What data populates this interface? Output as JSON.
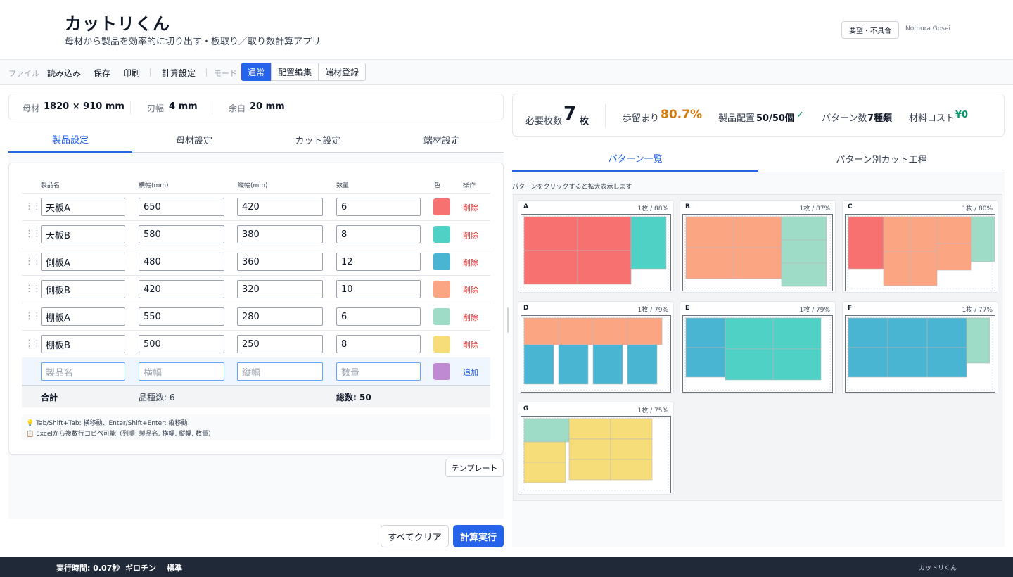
{
  "header": {
    "title": "カットリくん",
    "subtitle": "母材から製品を効率的に切り出す・板取り／取り数計算アプリ",
    "feedback_label": "要望・不具合",
    "company": "Nomura Gosei"
  },
  "toolbar": {
    "file_label": "ファイル",
    "load": "読み込み",
    "save": "保存",
    "print": "印刷",
    "calc_settings": "計算設定",
    "mode_label": "モード",
    "modes": [
      "通常",
      "配置編集",
      "端材登録"
    ],
    "active_mode": "通常"
  },
  "stock_bar": {
    "stock_label": "母材",
    "stock_value": "1820 × 910 mm",
    "kerf_label": "刃幅",
    "kerf_value": "4 mm",
    "margin_label": "余白",
    "margin_value": "20 mm"
  },
  "left_tabs": [
    "製品設定",
    "母材設定",
    "カット設定",
    "端材設定"
  ],
  "product_table": {
    "headers": [
      "製品名",
      "横幅(mm)",
      "縦幅(mm)",
      "数量",
      "色",
      "操作"
    ],
    "rows": [
      {
        "name": "天板A",
        "width": "650",
        "height": "420",
        "qty": "6",
        "color": "#f87171",
        "action": "削除"
      },
      {
        "name": "天板B",
        "width": "580",
        "height": "380",
        "qty": "8",
        "color": "#4fd1c5",
        "action": "削除"
      },
      {
        "name": "側板A",
        "width": "480",
        "height": "360",
        "qty": "12",
        "color": "#4ab5d2",
        "action": "削除"
      },
      {
        "name": "側板B",
        "width": "420",
        "height": "320",
        "qty": "10",
        "color": "#fca583",
        "action": "削除"
      },
      {
        "name": "棚板A",
        "width": "550",
        "height": "280",
        "qty": "6",
        "color": "#9fdcc8",
        "action": "削除"
      },
      {
        "name": "棚板B",
        "width": "500",
        "height": "250",
        "qty": "8",
        "color": "#f7dd7a",
        "action": "削除"
      }
    ],
    "new_row": {
      "name_placeholder": "製品名",
      "width_placeholder": "横幅",
      "height_placeholder": "縦幅",
      "qty_placeholder": "数量",
      "color": "#c08ad2",
      "action": "追加"
    },
    "total": {
      "label": "合計",
      "kinds": "品種数: 6",
      "count": "総数: 50"
    }
  },
  "hints": [
    "💡 Tab/Shift+Tab: 横移動、Enter/Shift+Enter: 縦移動",
    "📋 Excelから複数行コピペ可能（列順: 製品名, 横幅, 縦幅, 数量）"
  ],
  "buttons": {
    "template": "テンプレート",
    "clear": "すべてクリア",
    "run": "計算実行"
  },
  "summary": {
    "sheets_label": "必要枚数",
    "sheets_value": "7",
    "sheets_unit": "枚",
    "yield_label": "歩留まり",
    "yield_value": "80.7%",
    "placed_label": "製品配置",
    "placed_value": "50/50個",
    "placed_check": "✓",
    "patterns_label": "パターン数",
    "patterns_value": "7種類",
    "cost_label": "材料コスト",
    "cost_value": "¥0"
  },
  "right_tabs": [
    "パターン一覧",
    "パターン別カット工程"
  ],
  "pattern_hint": "パターンをクリックすると拡大表示します",
  "patterns": [
    {
      "label": "A",
      "info": "1枚 / 88%"
    },
    {
      "label": "B",
      "info": "1枚 / 87%"
    },
    {
      "label": "C",
      "info": "1枚 / 80%"
    },
    {
      "label": "D",
      "info": "1枚 / 79%"
    },
    {
      "label": "E",
      "info": "1枚 / 79%"
    },
    {
      "label": "F",
      "info": "1枚 / 77%"
    },
    {
      "label": "G",
      "info": "1枚 / 75%"
    }
  ],
  "footer": {
    "time": "実行時間: 0.07秒",
    "algo": "ギロチン",
    "level": "標準",
    "app": "カットリくん"
  },
  "colors": {
    "accent": "#2563eb",
    "yield": "#d97706",
    "cost": "#059669",
    "delete": "#dc2626"
  }
}
